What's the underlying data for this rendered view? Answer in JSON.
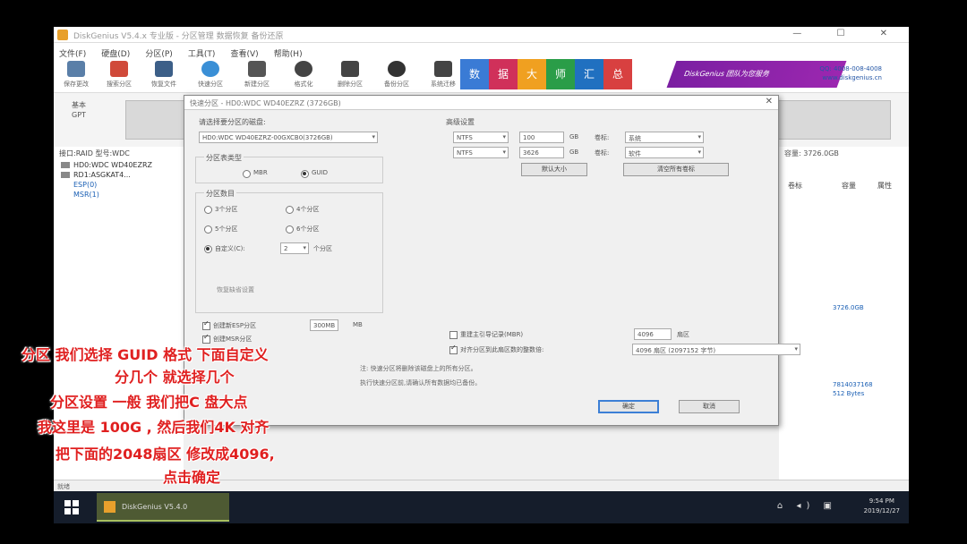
{
  "window": {
    "title": "DiskGenius V5.4.x 专业版 - 分区管理 数据恢复 备份还原",
    "controls": "— ☐ ✕"
  },
  "menu": [
    "文件(F)",
    "硬盘(D)",
    "分区(P)",
    "工具(T)",
    "查看(V)",
    "帮助(H)"
  ],
  "toolbar": [
    {
      "label": "保存更改",
      "icon": "save-icon",
      "color": "#5a7fa8"
    },
    {
      "label": "搜索分区",
      "icon": "search-icon",
      "color": "#d04a3a"
    },
    {
      "label": "恢复文件",
      "icon": "recover-icon",
      "color": "#3c5f88"
    },
    {
      "label": "快速分区",
      "icon": "quick-partition-icon",
      "color": "#3a8fd6"
    },
    {
      "label": "新建分区",
      "icon": "new-partition-icon",
      "color": "#555"
    },
    {
      "label": "格式化",
      "icon": "format-icon",
      "color": "#444"
    },
    {
      "label": "删除分区",
      "icon": "delete-icon",
      "color": "#444"
    },
    {
      "label": "备份分区",
      "icon": "backup-icon",
      "color": "#333"
    },
    {
      "label": "系统迁移",
      "icon": "migrate-icon",
      "color": "#444"
    }
  ],
  "banner": {
    "tiles": [
      {
        "glyph": "数",
        "color": "#3a7bd5"
      },
      {
        "glyph": "据",
        "color": "#d0305a"
      },
      {
        "glyph": "大",
        "color": "#f0a020"
      },
      {
        "glyph": "师",
        "color": "#2a9d48"
      },
      {
        "glyph": "汇",
        "color": "#2070c0"
      },
      {
        "glyph": "总",
        "color": "#d84040"
      }
    ],
    "brand": "DiskGenius 团队为您服务",
    "info_line1": "QQ: 4008-008-4008",
    "info_line2": "www.diskgenius.cn"
  },
  "disk_side": {
    "line1": "基本",
    "line2": "GPT"
  },
  "sidebar": {
    "header": "接口:RAID  型号:WDC",
    "items": [
      {
        "label": "HD0:WDC WD40EZRZ",
        "style": ""
      },
      {
        "label": "RD1:ASGKAT4...",
        "style": ""
      },
      {
        "label": "ESP(0)",
        "style": "blue"
      },
      {
        "label": "MSR(1)",
        "style": "blue"
      }
    ]
  },
  "right_panel": {
    "header": "容量: 3726.0GB",
    "col_name": "卷标",
    "col_cap": "容量",
    "col_attr": "属性",
    "blue1": "3726.0GB",
    "blue2": "7814037168",
    "blue3": "512 Bytes"
  },
  "dialog": {
    "title": "快速分区 - HD0:WDC WD40EZRZ (3726GB)",
    "close": "✕",
    "target_label": "请选择要分区的磁盘:",
    "target_value": "HD0:WDC WD40EZRZ-00GXCB0(3726GB)",
    "table_type_label": "分区表类型",
    "mbr": "MBR",
    "guid": "GUID",
    "count_label": "分区数目",
    "count_3": "3个分区",
    "count_4": "4个分区",
    "count_5": "5个分区",
    "count_6": "6个分区",
    "count_custom": "自定义(C):",
    "count_value": "2",
    "count_suffix": "个分区",
    "restore_default": "恢复缺省设置",
    "esp_label": "创建新ESP分区",
    "msr_label": "创建MSR分区",
    "esp_size": "300MB",
    "esp_unit": "MB",
    "layout_label": "高级设置",
    "row1_type": "NTFS",
    "row1_size": "100",
    "row1_unit": "GB",
    "row1_vol_label": "卷标:",
    "row1_vol": "系统",
    "row2_type": "NTFS",
    "row2_size": "3626",
    "row2_unit": "GB",
    "row2_vol_label": "卷标:",
    "row2_vol": "软件",
    "default_size_btn": "默认大小",
    "clear_labels_btn": "清空所有卷标",
    "rebuild_mbr": "重建主引导记录(MBR)",
    "align_label": "对齐分区到此扇区数的整数倍:",
    "align_sectors": "4096",
    "align_unit": "扇区",
    "align_select": "4096 扇区 (2097152 字节)",
    "note1": "注: 快速分区将删除该磁盘上的所有分区。",
    "note2": "执行快速分区前,请确认所有数据均已备份。",
    "ok": "确定",
    "cancel": "取消"
  },
  "status": "就绪",
  "taskbar": {
    "app": "DiskGenius V5.4.0",
    "time": "9:54 PM",
    "date": "2019/12/27",
    "tray": "⌂ ◂) ▣"
  },
  "subtitles": [
    "分区 我们选择 GUID 格式  下面自定义",
    "分几个 就选择几个",
    "分区设置 一般 我们把C 盘大点",
    "我这里是 100G  , 然后我们4K 对齐",
    "把下面的2048扇区 修改成4096,",
    "点击确定"
  ]
}
